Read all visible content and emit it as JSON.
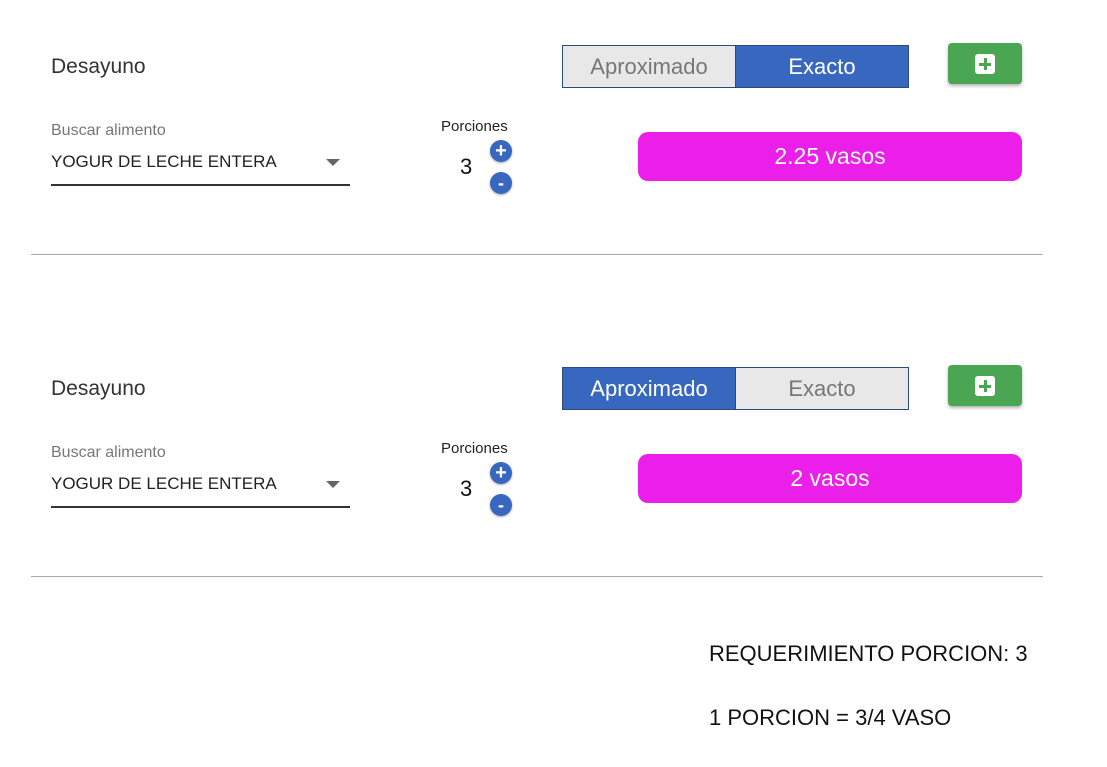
{
  "colors": {
    "toggle_active": "#3867bf",
    "toggle_inactive": "#e8e8e8",
    "add_button": "#4aa652",
    "result_pill": "#ec1ee9",
    "round_button": "#3867bf"
  },
  "sections": [
    {
      "meal_title": "Desayuno",
      "toggle": {
        "option_1": "Aproximado",
        "option_2": "Exacto",
        "selected": "Exacto"
      },
      "add_icon": "plus-square-icon",
      "search_label": "Buscar alimento",
      "search_value": "YOGUR DE LECHE ENTERA",
      "portions_label": "Porciones",
      "portions_value": "3",
      "increment_label": "+",
      "decrement_label": "-",
      "result": "2.25 vasos"
    },
    {
      "meal_title": "Desayuno",
      "toggle": {
        "option_1": "Aproximado",
        "option_2": "Exacto",
        "selected": "Aproximado"
      },
      "add_icon": "plus-square-icon",
      "search_label": "Buscar alimento",
      "search_value": "YOGUR DE LECHE ENTERA",
      "portions_label": "Porciones",
      "portions_value": "3",
      "increment_label": "+",
      "decrement_label": "-",
      "result": "2 vasos"
    }
  ],
  "notes": {
    "requirement": "REQUERIMIENTO PORCION: 3",
    "equivalence": "1 PORCION = 3/4 VASO"
  }
}
